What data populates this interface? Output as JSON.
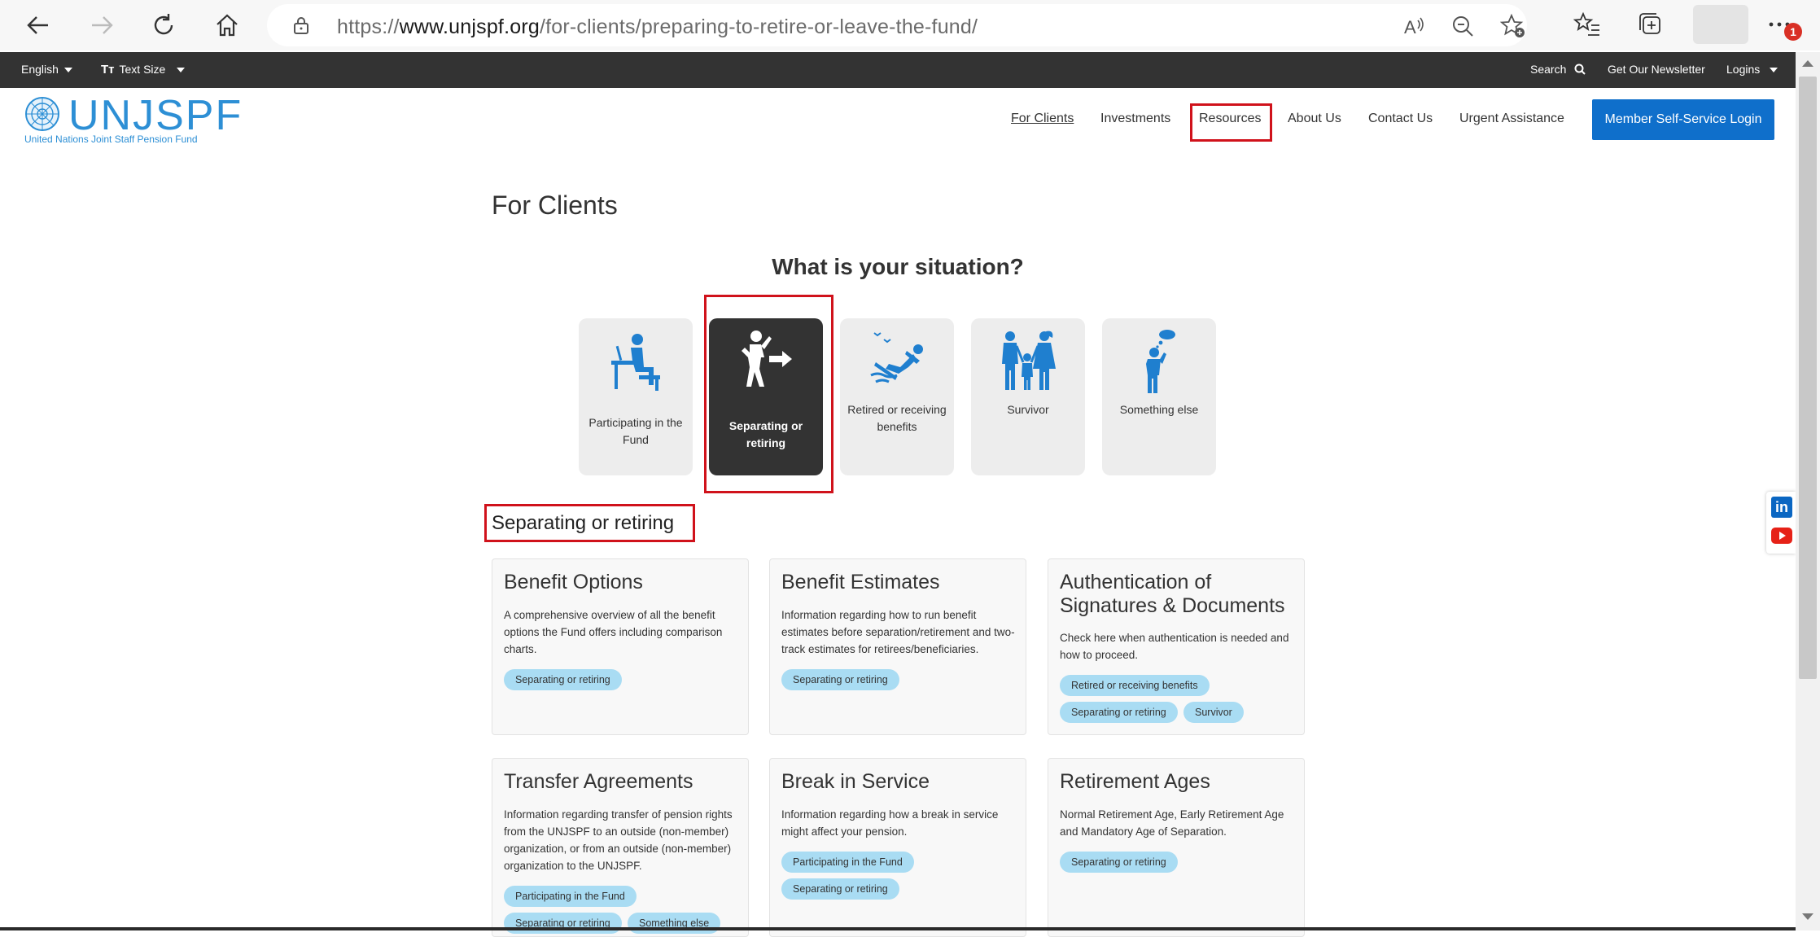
{
  "browser": {
    "url_scheme": "https://",
    "url_host": "www.unjspf.org",
    "url_path": "/for-clients/preparing-to-retire-or-leave-the-fund/",
    "notification_count": "1"
  },
  "util_bar": {
    "language": "English",
    "text_size": "Text Size",
    "search": "Search",
    "newsletter": "Get Our Newsletter",
    "logins": "Logins"
  },
  "header": {
    "logo_text": "UNJSPF",
    "logo_subtitle": "United Nations Joint Staff Pension Fund",
    "nav": [
      "For Clients",
      "Investments",
      "Resources",
      "About Us",
      "Contact Us",
      "Urgent Assistance"
    ],
    "login_button": "Member Self-Service Login"
  },
  "main": {
    "page_title": "For Clients",
    "situation_title": "What is your situation?",
    "situations": [
      {
        "label": "Participating in the Fund",
        "icon": "person-at-desk-icon",
        "active": false
      },
      {
        "label": "Separating or retiring",
        "icon": "person-leaving-icon",
        "active": true
      },
      {
        "label": "Retired or receiving benefits",
        "icon": "person-relaxing-icon",
        "active": false
      },
      {
        "label": "Survivor",
        "icon": "family-icon",
        "active": false
      },
      {
        "label": "Something else",
        "icon": "person-thinking-icon",
        "active": false
      }
    ],
    "section_heading": "Separating or retiring",
    "cards": [
      {
        "title": "Benefit Options",
        "description": "A comprehensive overview of all the benefit options the Fund offers including comparison charts.",
        "tags": [
          "Separating or retiring"
        ]
      },
      {
        "title": "Benefit Estimates",
        "description": "Information regarding how to run benefit estimates before separation/retirement and two-track estimates for retirees/beneficiaries.",
        "tags": [
          "Separating or retiring"
        ]
      },
      {
        "title": "Authentication of Signatures & Documents",
        "description": "Check here when authentication is needed and how to proceed.",
        "tags": [
          "Retired or receiving benefits",
          "Separating or retiring",
          "Survivor"
        ]
      },
      {
        "title": "Transfer Agreements",
        "description": "Information regarding transfer of pension rights from the UNJSPF to an outside (non-member) organization, or from an outside (non-member) organization to the UNJSPF.",
        "tags": [
          "Participating in the Fund",
          "Separating or retiring",
          "Something else"
        ]
      },
      {
        "title": "Break in Service",
        "description": "Information regarding how a break in service might affect your pension.",
        "tags": [
          "Participating in the Fund",
          "Separating or retiring"
        ]
      },
      {
        "title": "Retirement Ages",
        "description": "Normal Retirement Age, Early Retirement Age and Mandatory Age of Separation.",
        "tags": [
          "Separating or retiring"
        ]
      }
    ]
  },
  "colors": {
    "brand_blue": "#2d8fd5",
    "button_blue": "#0f6fcb",
    "dark_bar": "#333333",
    "tag_blue": "#a9dcf3",
    "highlight_red": "#d0121b"
  }
}
